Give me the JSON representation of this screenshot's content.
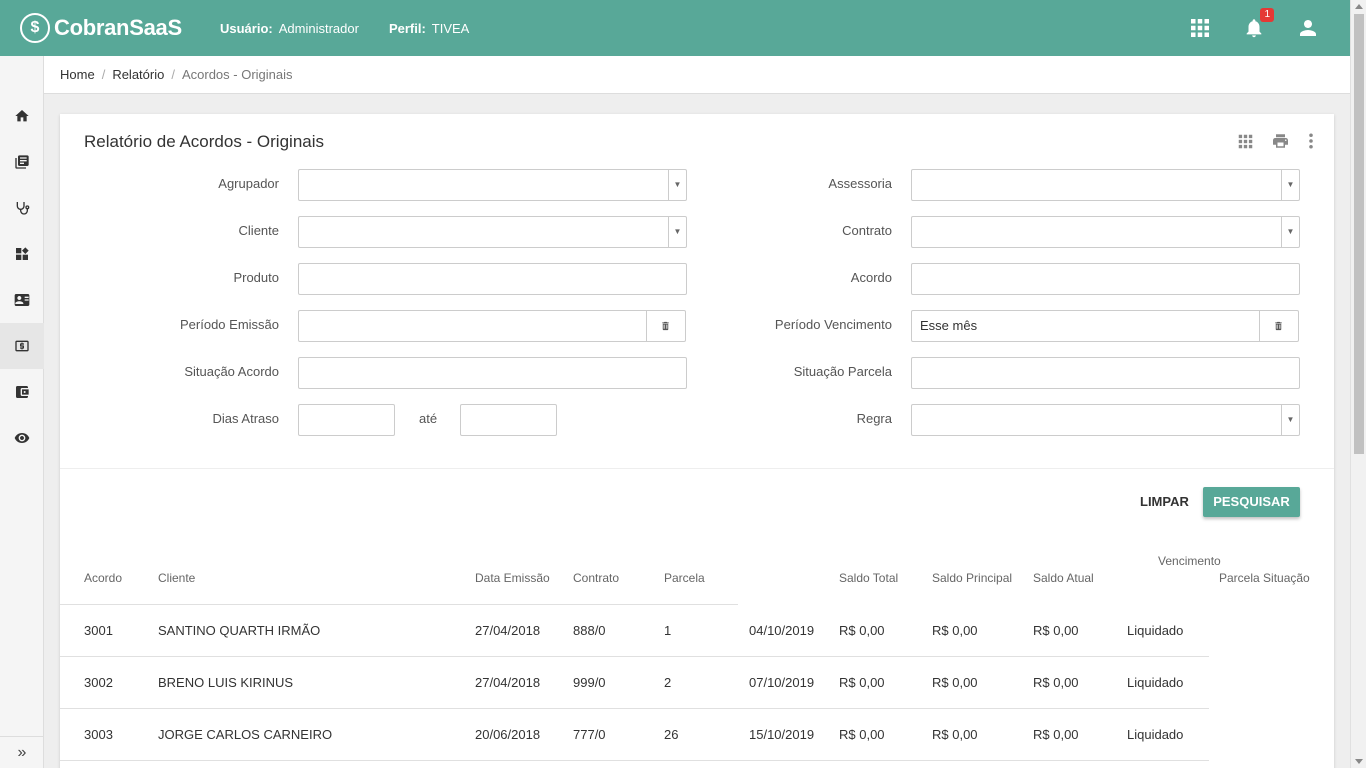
{
  "header": {
    "logo_mark": "$",
    "logo_text": "CobranSaaS",
    "user_label": "Usuário:",
    "user_value": "Administrador",
    "profile_label": "Perfil:",
    "profile_value": "TIVEA",
    "notification_count": "1"
  },
  "breadcrumb": {
    "home": "Home",
    "report": "Relatório",
    "current": "Acordos - Originais",
    "separator": "/"
  },
  "page": {
    "title": "Relatório de Acordos - Originais"
  },
  "filters": {
    "agrupador": {
      "label": "Agrupador",
      "value": ""
    },
    "assessoria": {
      "label": "Assessoria",
      "value": ""
    },
    "cliente": {
      "label": "Cliente",
      "value": ""
    },
    "contrato": {
      "label": "Contrato",
      "value": ""
    },
    "produto": {
      "label": "Produto",
      "value": ""
    },
    "acordo": {
      "label": "Acordo",
      "value": ""
    },
    "periodo_emissao": {
      "label": "Período Emissão",
      "value": ""
    },
    "periodo_vencimento": {
      "label": "Período Vencimento",
      "value": "Esse mês"
    },
    "situacao_acordo": {
      "label": "Situação Acordo",
      "value": ""
    },
    "situacao_parcela": {
      "label": "Situação Parcela",
      "value": ""
    },
    "dias_atraso": {
      "label": "Dias Atraso",
      "from": "",
      "to": "",
      "between_label": "até"
    },
    "regra": {
      "label": "Regra",
      "value": ""
    }
  },
  "actions": {
    "clear_label": "LIMPAR",
    "search_label": "PESQUISAR"
  },
  "table": {
    "headers": {
      "acordo": "Acordo",
      "cliente": "Cliente",
      "data_emissao": "Data Emissão",
      "contrato": "Contrato",
      "parcela": "Parcela",
      "saldo_total": "Saldo Total",
      "saldo_principal": "Saldo Principal",
      "saldo_atual": "Saldo Atual",
      "vencimento": "Vencimento",
      "parcela_situacao": "Parcela Situação"
    },
    "rows": [
      {
        "acordo": "3001",
        "cliente": "SANTINO QUARTH IRMÃO",
        "data_emissao": "27/04/2018",
        "contrato": "888/0",
        "parcela": "1",
        "vencimento": "04/10/2019",
        "saldo_total": "R$ 0,00",
        "saldo_principal": "R$ 0,00",
        "saldo_atual": "R$ 0,00",
        "situacao": "Liquidado"
      },
      {
        "acordo": "3002",
        "cliente": "BRENO LUIS KIRINUS",
        "data_emissao": "27/04/2018",
        "contrato": "999/0",
        "parcela": "2",
        "vencimento": "07/10/2019",
        "saldo_total": "R$ 0,00",
        "saldo_principal": "R$ 0,00",
        "saldo_atual": "R$ 0,00",
        "situacao": "Liquidado"
      },
      {
        "acordo": "3003",
        "cliente": "JORGE CARLOS CARNEIRO",
        "data_emissao": "20/06/2018",
        "contrato": "777/0",
        "parcela": "26",
        "vencimento": "15/10/2019",
        "saldo_total": "R$ 0,00",
        "saldo_principal": "R$ 0,00",
        "saldo_atual": "R$ 0,00",
        "situacao": "Liquidado"
      }
    ]
  },
  "colors": {
    "brand": "#58a898",
    "badge": "#e53935"
  },
  "icons": {
    "sidebar": [
      "home-icon",
      "library-books-icon",
      "stethoscope-icon",
      "dashboard-icon",
      "contact-card-icon",
      "money-icon",
      "wallet-icon",
      "eye-icon"
    ],
    "top": [
      "apps-grid-icon",
      "bell-icon",
      "person-icon"
    ],
    "card_tools": [
      "grid-icon",
      "print-icon",
      "more-vert-icon"
    ]
  }
}
